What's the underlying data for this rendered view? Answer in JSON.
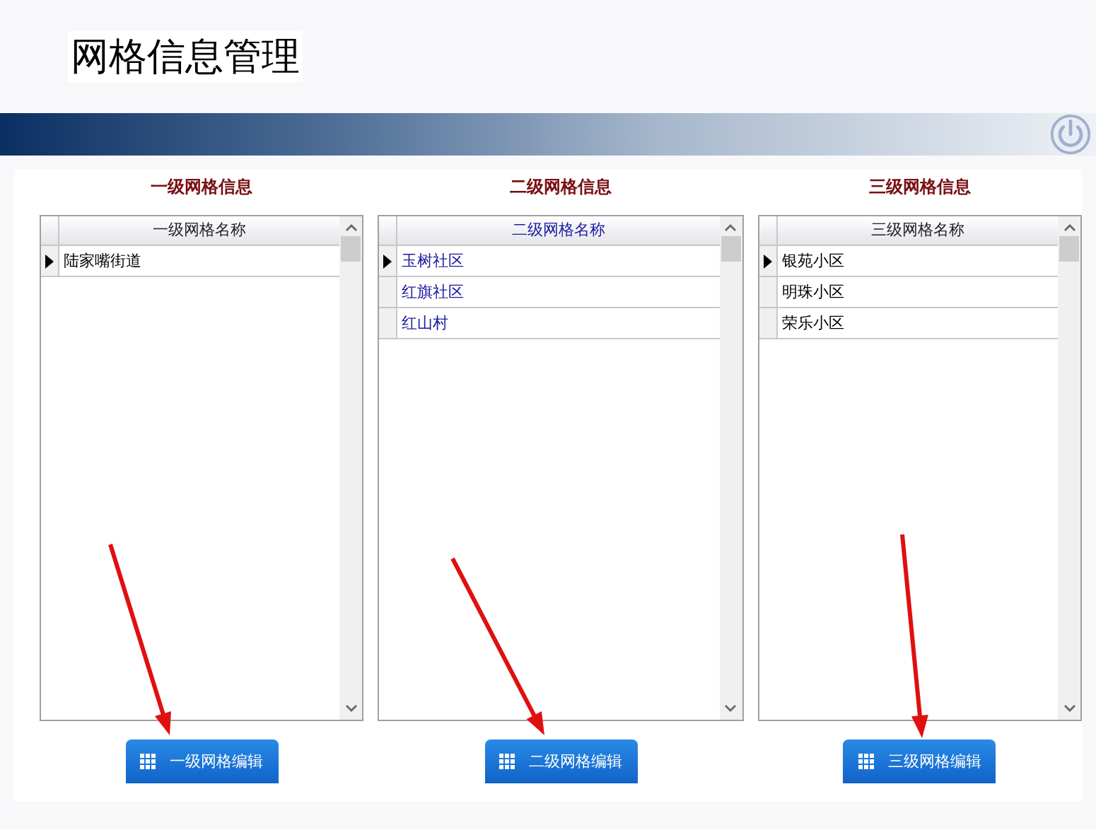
{
  "page": {
    "title": "网格信息管理"
  },
  "panels": [
    {
      "heading": "一级网格信息",
      "column": "一级网格名称",
      "focused": false,
      "rows": [
        {
          "name": "陆家嘴街道",
          "selected": true
        }
      ],
      "button": "一级网格编辑"
    },
    {
      "heading": "二级网格信息",
      "column": "二级网格名称",
      "focused": true,
      "rows": [
        {
          "name": "玉树社区",
          "selected": true
        },
        {
          "name": "红旗社区",
          "selected": false
        },
        {
          "name": "红山村",
          "selected": false
        }
      ],
      "button": "二级网格编辑"
    },
    {
      "heading": "三级网格信息",
      "column": "三级网格名称",
      "focused": false,
      "rows": [
        {
          "name": "银苑小区",
          "selected": true
        },
        {
          "name": "明珠小区",
          "selected": false
        },
        {
          "name": "荣乐小区",
          "selected": false
        }
      ],
      "button": "三级网格编辑"
    }
  ]
}
